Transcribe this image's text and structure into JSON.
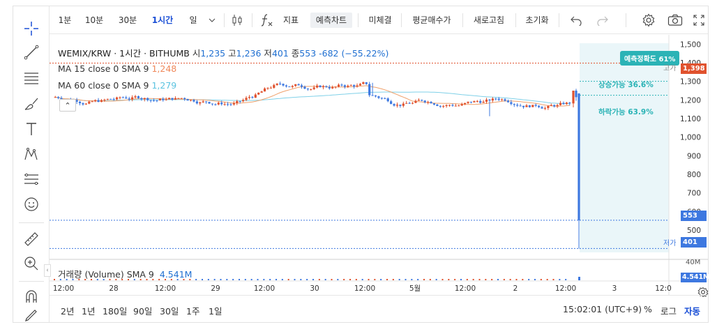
{
  "toolbar": {
    "intervals": [
      "1분",
      "10분",
      "30분",
      "1시간",
      "일"
    ],
    "indicator_label": "지표",
    "prediction_chart_label": "예측차트",
    "unfilled_label": "미체결",
    "avg_price_label": "평균매수가",
    "refresh_label": "새로고침",
    "reset_label": "초기화"
  },
  "legend": {
    "title": "WEMIX/KRW · 1시간 · BITHUMB",
    "open_label": "시",
    "open": "1,235",
    "high_label": "고",
    "high": "1,236",
    "low_label": "저",
    "low": "401",
    "close_label": "종",
    "close": "553",
    "change": "-682 (−55.22%)",
    "ma15_label": "MA 15 close 0 SMA 9",
    "ma15_value": "1,248",
    "ma60_label": "MA 60 close 0 SMA 9",
    "ma60_value": "1,279"
  },
  "prediction": {
    "accuracy": "예측정확도 61%",
    "up": "상승가능 36.6%",
    "down": "하락가능 63.9%"
  },
  "price_axis": {
    "ticks": [
      "1,500",
      "1,400",
      "1,300",
      "1,200",
      "1,100",
      "1,000",
      "900",
      "800",
      "700",
      "600",
      "500"
    ],
    "high_label": "고가",
    "high_value": "1,398",
    "last_value": "553",
    "low_label": "저가",
    "low_value": "401"
  },
  "volume": {
    "label": "거래량 (Volume) SMA 9",
    "value": "4.541M",
    "axis_tick": "40M",
    "badge": "4.541M"
  },
  "time_axis": {
    "ticks": [
      "12:00",
      "28",
      "12:00",
      "29",
      "12:00",
      "30",
      "12:00",
      "5월",
      "12:00",
      "2",
      "12:00",
      "3",
      "12:0"
    ]
  },
  "bottom": {
    "ranges": [
      "2년",
      "1년",
      "180일",
      "90일",
      "30일",
      "1주",
      "1일"
    ],
    "time": "15:02:01 (UTC+9)",
    "percent": "%",
    "log": "로그",
    "auto": "자동"
  },
  "colors": {
    "up": "#e0522e",
    "down": "#3d78e0",
    "ma15": "#f0a06a",
    "ma60": "#7fd0e8",
    "accent": "#1a4fd6",
    "prediction": "#2bb3b6"
  },
  "chart_data": {
    "type": "candlestick",
    "interval": "1h",
    "x_labels": [
      "12:00",
      "28",
      "12:00",
      "29",
      "12:00",
      "30",
      "12:00",
      "5월",
      "12:00",
      "2",
      "12:00",
      "3"
    ],
    "ylim": [
      380,
      1520
    ],
    "open": 1235,
    "high": 1236,
    "low": 401,
    "close": 553,
    "period_high": 1398,
    "period_low": 401,
    "ma15": 1248,
    "ma60": 1279
  }
}
